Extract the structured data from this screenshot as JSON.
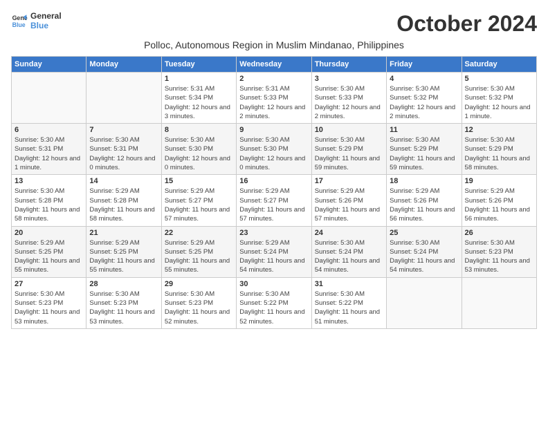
{
  "logo": {
    "line1": "General",
    "line2": "Blue"
  },
  "title": "October 2024",
  "subtitle": "Polloc, Autonomous Region in Muslim Mindanao, Philippines",
  "headers": [
    "Sunday",
    "Monday",
    "Tuesday",
    "Wednesday",
    "Thursday",
    "Friday",
    "Saturday"
  ],
  "weeks": [
    [
      {
        "day": "",
        "info": ""
      },
      {
        "day": "",
        "info": ""
      },
      {
        "day": "1",
        "info": "Sunrise: 5:31 AM\nSunset: 5:34 PM\nDaylight: 12 hours and 3 minutes."
      },
      {
        "day": "2",
        "info": "Sunrise: 5:31 AM\nSunset: 5:33 PM\nDaylight: 12 hours and 2 minutes."
      },
      {
        "day": "3",
        "info": "Sunrise: 5:30 AM\nSunset: 5:33 PM\nDaylight: 12 hours and 2 minutes."
      },
      {
        "day": "4",
        "info": "Sunrise: 5:30 AM\nSunset: 5:32 PM\nDaylight: 12 hours and 2 minutes."
      },
      {
        "day": "5",
        "info": "Sunrise: 5:30 AM\nSunset: 5:32 PM\nDaylight: 12 hours and 1 minute."
      }
    ],
    [
      {
        "day": "6",
        "info": "Sunrise: 5:30 AM\nSunset: 5:31 PM\nDaylight: 12 hours and 1 minute."
      },
      {
        "day": "7",
        "info": "Sunrise: 5:30 AM\nSunset: 5:31 PM\nDaylight: 12 hours and 0 minutes."
      },
      {
        "day": "8",
        "info": "Sunrise: 5:30 AM\nSunset: 5:30 PM\nDaylight: 12 hours and 0 minutes."
      },
      {
        "day": "9",
        "info": "Sunrise: 5:30 AM\nSunset: 5:30 PM\nDaylight: 12 hours and 0 minutes."
      },
      {
        "day": "10",
        "info": "Sunrise: 5:30 AM\nSunset: 5:29 PM\nDaylight: 11 hours and 59 minutes."
      },
      {
        "day": "11",
        "info": "Sunrise: 5:30 AM\nSunset: 5:29 PM\nDaylight: 11 hours and 59 minutes."
      },
      {
        "day": "12",
        "info": "Sunrise: 5:30 AM\nSunset: 5:29 PM\nDaylight: 11 hours and 58 minutes."
      }
    ],
    [
      {
        "day": "13",
        "info": "Sunrise: 5:30 AM\nSunset: 5:28 PM\nDaylight: 11 hours and 58 minutes."
      },
      {
        "day": "14",
        "info": "Sunrise: 5:29 AM\nSunset: 5:28 PM\nDaylight: 11 hours and 58 minutes."
      },
      {
        "day": "15",
        "info": "Sunrise: 5:29 AM\nSunset: 5:27 PM\nDaylight: 11 hours and 57 minutes."
      },
      {
        "day": "16",
        "info": "Sunrise: 5:29 AM\nSunset: 5:27 PM\nDaylight: 11 hours and 57 minutes."
      },
      {
        "day": "17",
        "info": "Sunrise: 5:29 AM\nSunset: 5:26 PM\nDaylight: 11 hours and 57 minutes."
      },
      {
        "day": "18",
        "info": "Sunrise: 5:29 AM\nSunset: 5:26 PM\nDaylight: 11 hours and 56 minutes."
      },
      {
        "day": "19",
        "info": "Sunrise: 5:29 AM\nSunset: 5:26 PM\nDaylight: 11 hours and 56 minutes."
      }
    ],
    [
      {
        "day": "20",
        "info": "Sunrise: 5:29 AM\nSunset: 5:25 PM\nDaylight: 11 hours and 55 minutes."
      },
      {
        "day": "21",
        "info": "Sunrise: 5:29 AM\nSunset: 5:25 PM\nDaylight: 11 hours and 55 minutes."
      },
      {
        "day": "22",
        "info": "Sunrise: 5:29 AM\nSunset: 5:25 PM\nDaylight: 11 hours and 55 minutes."
      },
      {
        "day": "23",
        "info": "Sunrise: 5:29 AM\nSunset: 5:24 PM\nDaylight: 11 hours and 54 minutes."
      },
      {
        "day": "24",
        "info": "Sunrise: 5:30 AM\nSunset: 5:24 PM\nDaylight: 11 hours and 54 minutes."
      },
      {
        "day": "25",
        "info": "Sunrise: 5:30 AM\nSunset: 5:24 PM\nDaylight: 11 hours and 54 minutes."
      },
      {
        "day": "26",
        "info": "Sunrise: 5:30 AM\nSunset: 5:23 PM\nDaylight: 11 hours and 53 minutes."
      }
    ],
    [
      {
        "day": "27",
        "info": "Sunrise: 5:30 AM\nSunset: 5:23 PM\nDaylight: 11 hours and 53 minutes."
      },
      {
        "day": "28",
        "info": "Sunrise: 5:30 AM\nSunset: 5:23 PM\nDaylight: 11 hours and 53 minutes."
      },
      {
        "day": "29",
        "info": "Sunrise: 5:30 AM\nSunset: 5:23 PM\nDaylight: 11 hours and 52 minutes."
      },
      {
        "day": "30",
        "info": "Sunrise: 5:30 AM\nSunset: 5:22 PM\nDaylight: 11 hours and 52 minutes."
      },
      {
        "day": "31",
        "info": "Sunrise: 5:30 AM\nSunset: 5:22 PM\nDaylight: 11 hours and 51 minutes."
      },
      {
        "day": "",
        "info": ""
      },
      {
        "day": "",
        "info": ""
      }
    ]
  ]
}
